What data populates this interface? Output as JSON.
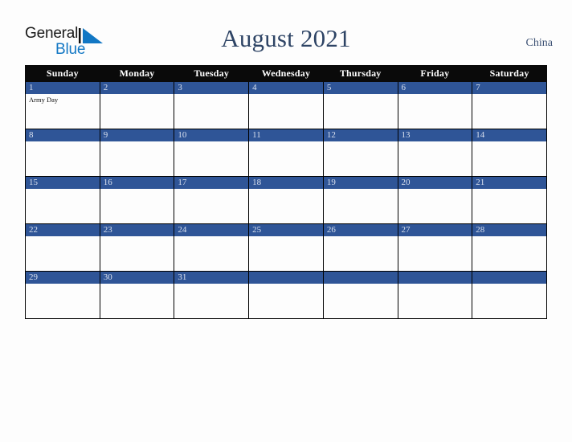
{
  "brand": {
    "name_part1": "General",
    "name_part2": "Blue",
    "triangle_color": "#1277C4",
    "text_color": "#1A1A1A"
  },
  "header": {
    "title": "August 2021",
    "country": "China",
    "title_color": "#2E4465"
  },
  "colors": {
    "header_row_bg": "#0A0A0A",
    "date_bar_bg": "#2F5597",
    "date_text": "#D9E0EE",
    "cell_bg": "#FDFDFD",
    "grid_line": "#000000",
    "page_bg": "#FDFDFD"
  },
  "calendar": {
    "weekday_headers": [
      "Sunday",
      "Monday",
      "Tuesday",
      "Wednesday",
      "Thursday",
      "Friday",
      "Saturday"
    ],
    "weeks": [
      [
        {
          "day": "1",
          "events": [
            "Army Day"
          ]
        },
        {
          "day": "2",
          "events": []
        },
        {
          "day": "3",
          "events": []
        },
        {
          "day": "4",
          "events": []
        },
        {
          "day": "5",
          "events": []
        },
        {
          "day": "6",
          "events": []
        },
        {
          "day": "7",
          "events": []
        }
      ],
      [
        {
          "day": "8",
          "events": []
        },
        {
          "day": "9",
          "events": []
        },
        {
          "day": "10",
          "events": []
        },
        {
          "day": "11",
          "events": []
        },
        {
          "day": "12",
          "events": []
        },
        {
          "day": "13",
          "events": []
        },
        {
          "day": "14",
          "events": []
        }
      ],
      [
        {
          "day": "15",
          "events": []
        },
        {
          "day": "16",
          "events": []
        },
        {
          "day": "17",
          "events": []
        },
        {
          "day": "18",
          "events": []
        },
        {
          "day": "19",
          "events": []
        },
        {
          "day": "20",
          "events": []
        },
        {
          "day": "21",
          "events": []
        }
      ],
      [
        {
          "day": "22",
          "events": []
        },
        {
          "day": "23",
          "events": []
        },
        {
          "day": "24",
          "events": []
        },
        {
          "day": "25",
          "events": []
        },
        {
          "day": "26",
          "events": []
        },
        {
          "day": "27",
          "events": []
        },
        {
          "day": "28",
          "events": []
        }
      ],
      [
        {
          "day": "29",
          "events": []
        },
        {
          "day": "30",
          "events": []
        },
        {
          "day": "31",
          "events": []
        },
        {
          "day": "",
          "events": []
        },
        {
          "day": "",
          "events": []
        },
        {
          "day": "",
          "events": []
        },
        {
          "day": "",
          "events": []
        }
      ]
    ]
  }
}
